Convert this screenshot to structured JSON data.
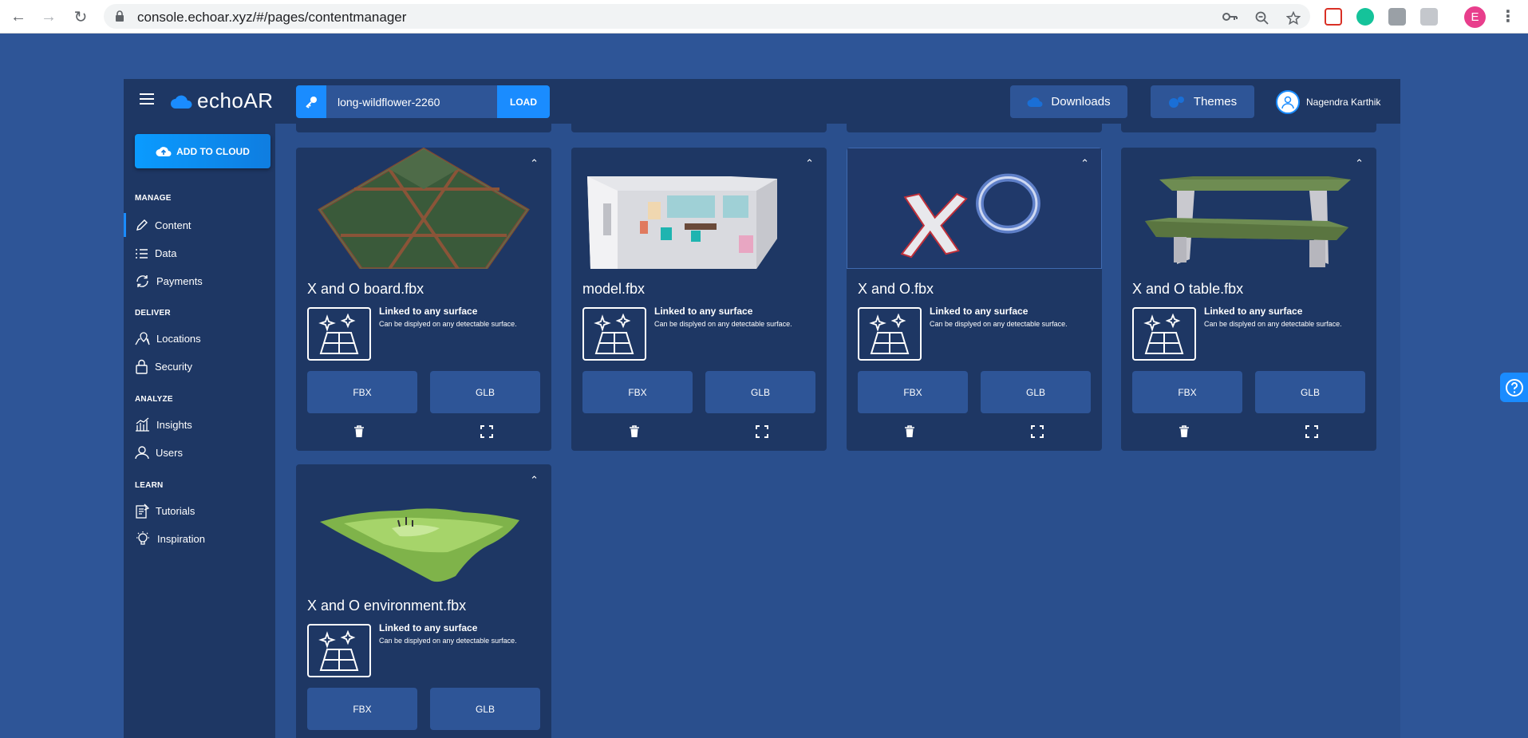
{
  "browser": {
    "url": "console.echoar.xyz/#/pages/contentmanager",
    "profile_initial": "E"
  },
  "app": {
    "logo_text": "echoAR",
    "api_key": "long-wildflower-2260",
    "load_label": "LOAD",
    "downloads_label": "Downloads",
    "themes_label": "Themes",
    "user_name": "Nagendra Karthik",
    "accent_color": "#1a8cff"
  },
  "sidebar": {
    "add_to_cloud": "ADD TO CLOUD",
    "sections": {
      "manage": "MANAGE",
      "deliver": "DELIVER",
      "analyze": "ANALYZE",
      "learn": "LEARN"
    },
    "items": [
      {
        "label": "Content",
        "icon": "pencil-icon"
      },
      {
        "label": "Data",
        "icon": "list-icon"
      },
      {
        "label": "Payments",
        "icon": "refresh-icon"
      },
      {
        "label": "Locations",
        "icon": "map-pin-icon"
      },
      {
        "label": "Security",
        "icon": "lock-icon"
      },
      {
        "label": "Insights",
        "icon": "chart-icon"
      },
      {
        "label": "Users",
        "icon": "user-icon"
      },
      {
        "label": "Tutorials",
        "icon": "document-icon"
      },
      {
        "label": "Inspiration",
        "icon": "lightbulb-icon"
      }
    ]
  },
  "cards": [
    {
      "name": "X and O board.fbx",
      "anchor_title": "Linked to any surface",
      "anchor_sub": "Can be displyed on any detectable surface.",
      "fbx": "FBX",
      "glb": "GLB"
    },
    {
      "name": "model.fbx",
      "anchor_title": "Linked to any surface",
      "anchor_sub": "Can be displyed on any detectable surface.",
      "fbx": "FBX",
      "glb": "GLB"
    },
    {
      "name": "X and O.fbx",
      "anchor_title": "Linked to any surface",
      "anchor_sub": "Can be displyed on any detectable surface.",
      "fbx": "FBX",
      "glb": "GLB"
    },
    {
      "name": "X and O table.fbx",
      "anchor_title": "Linked to any surface",
      "anchor_sub": "Can be displyed on any detectable surface.",
      "fbx": "FBX",
      "glb": "GLB"
    },
    {
      "name": "X and O environment.fbx",
      "anchor_title": "Linked to any surface",
      "anchor_sub": "Can be displyed on any detectable surface.",
      "fbx": "FBX",
      "glb": "GLB"
    }
  ]
}
